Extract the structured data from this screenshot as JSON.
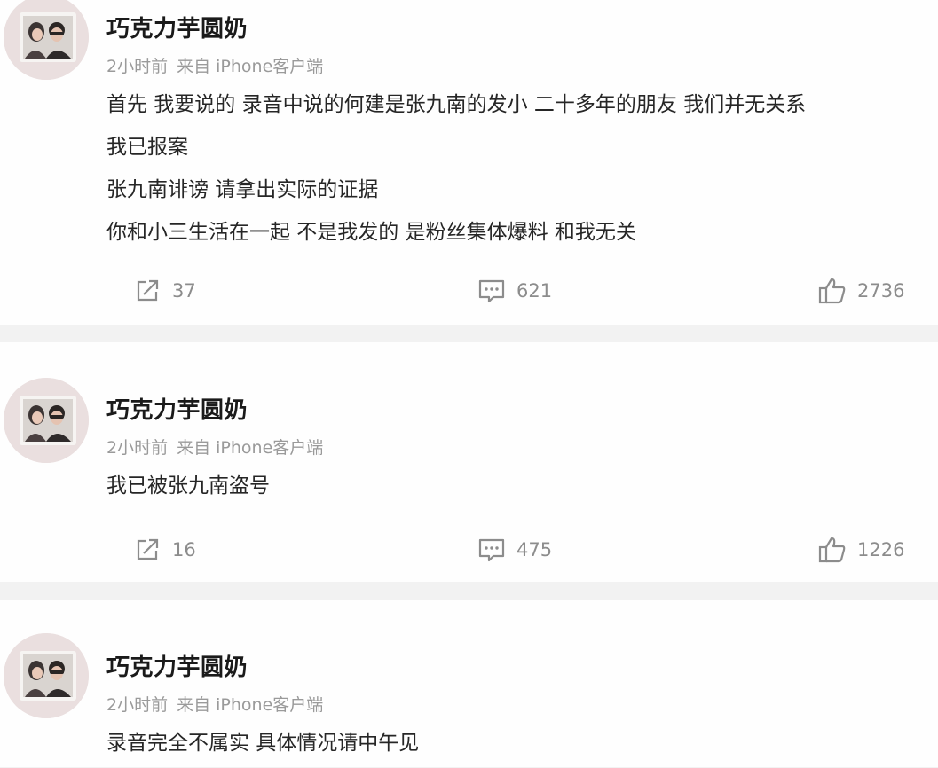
{
  "posts": [
    {
      "username": "巧克力芋圆奶",
      "time": "2小时前",
      "source": "来自 iPhone客户端",
      "lines": [
        "首先 我要说的 录音中说的何建是张九南的发小 二十多年的朋友 我们并无关系",
        "我已报案",
        "张九南诽谤 请拿出实际的证据",
        "你和小三生活在一起 不是我发的 是粉丝集体爆料 和我无关"
      ],
      "reposts": "37",
      "comments": "621",
      "likes": "2736"
    },
    {
      "username": "巧克力芋圆奶",
      "time": "2小时前",
      "source": "来自 iPhone客户端",
      "lines": [
        "我已被张九南盗号"
      ],
      "reposts": "16",
      "comments": "475",
      "likes": "1226"
    },
    {
      "username": "巧克力芋圆奶",
      "time": "2小时前",
      "source": "来自 iPhone客户端",
      "lines": [
        "录音完全不属实 具体情况请中午见"
      ]
    }
  ],
  "icons": {
    "repost": "repost-icon",
    "comment": "comment-icon",
    "like": "like-icon"
  },
  "colors": {
    "background": "#f2f2f2",
    "card": "#fefefe",
    "meta_text": "#9a9a9a",
    "action_text": "#8c8c8c"
  }
}
